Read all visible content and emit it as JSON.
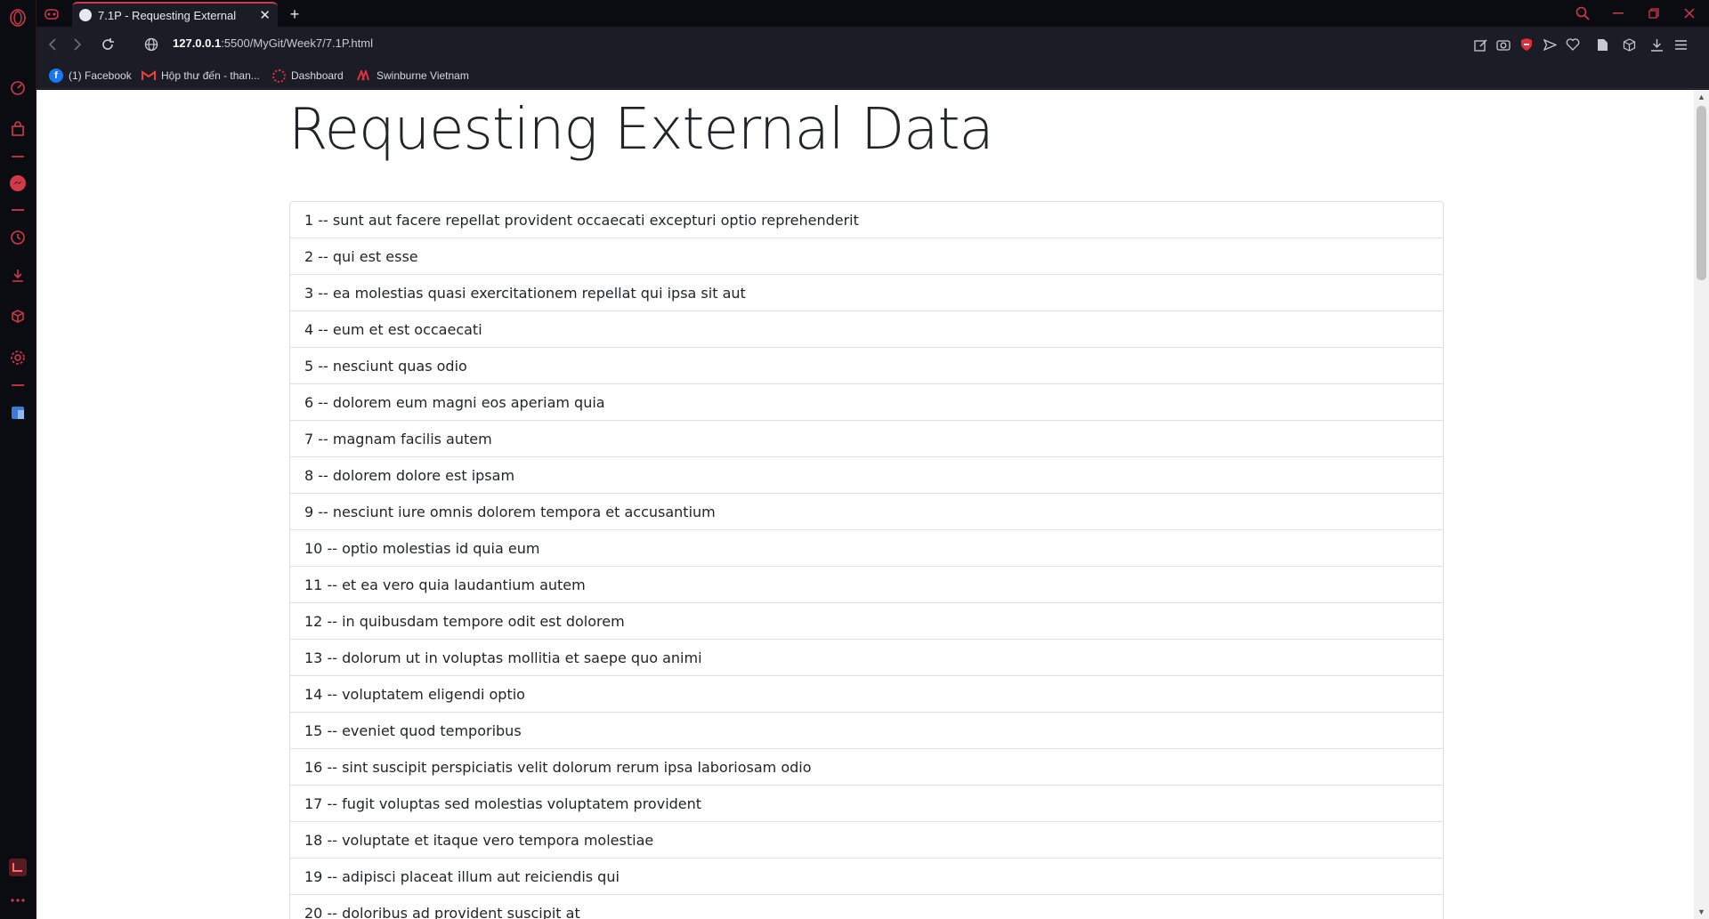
{
  "browser": {
    "tab_title": "7.1P - Requesting External",
    "url_host": "127.0.0.1",
    "url_path": ":5500/MyGit/Week7/7.1P.html",
    "accent_color": "#d13a4a"
  },
  "bookmarks": [
    {
      "label": "(1) Facebook",
      "icon": "facebook-icon"
    },
    {
      "label": "Hộp thư đến - than...",
      "icon": "gmail-icon"
    },
    {
      "label": "Dashboard",
      "icon": "dashboard-icon"
    },
    {
      "label": "Swinburne Vietnam",
      "icon": "swinburne-icon"
    }
  ],
  "page": {
    "title": "Requesting External Data",
    "posts": [
      "1 -- sunt aut facere repellat provident occaecati excepturi optio reprehenderit",
      "2 -- qui est esse",
      "3 -- ea molestias quasi exercitationem repellat qui ipsa sit aut",
      "4 -- eum et est occaecati",
      "5 -- nesciunt quas odio",
      "6 -- dolorem eum magni eos aperiam quia",
      "7 -- magnam facilis autem",
      "8 -- dolorem dolore est ipsam",
      "9 -- nesciunt iure omnis dolorem tempora et accusantium",
      "10 -- optio molestias id quia eum",
      "11 -- et ea vero quia laudantium autem",
      "12 -- in quibusdam tempore odit est dolorem",
      "13 -- dolorum ut in voluptas mollitia et saepe quo animi",
      "14 -- voluptatem eligendi optio",
      "15 -- eveniet quod temporibus",
      "16 -- sint suscipit perspiciatis velit dolorum rerum ipsa laboriosam odio",
      "17 -- fugit voluptas sed molestias voluptatem provident",
      "18 -- voluptate et itaque vero tempora molestiae",
      "19 -- adipisci placeat illum aut reiciendis qui",
      "20 -- doloribus ad provident suscipit at"
    ]
  }
}
